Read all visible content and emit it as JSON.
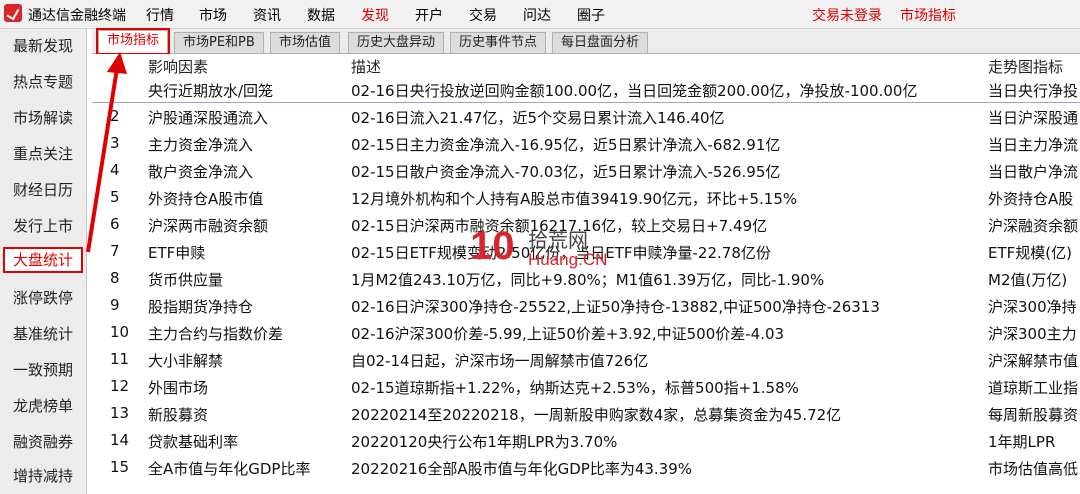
{
  "menubar": {
    "app_title": "通达信金融终端",
    "items": [
      "行情",
      "市场",
      "资讯",
      "数据",
      "发现",
      "开户",
      "交易",
      "问达",
      "圈子"
    ],
    "active_item": "发现",
    "status": "交易未登录",
    "right_link": "市场指标",
    "accent_color": "#e00000"
  },
  "sidebar": {
    "items": [
      "最新发现",
      "热点专题",
      "市场解读",
      "重点关注",
      "财经日历",
      "发行上市",
      "大盘统计",
      "涨停跌停",
      "基准统计",
      "一致预期",
      "龙虎榜单",
      "融资融券",
      "增持减持"
    ],
    "active_item": "大盘统计"
  },
  "tabs": {
    "items": [
      "市场指标",
      "市场PE和PB",
      "市场估值",
      "历史大盘异动",
      "历史事件节点",
      "每日盘面分析"
    ],
    "active_item": "市场指标"
  },
  "table": {
    "headers": {
      "factor": "影响因素",
      "desc": "描述",
      "chart": "走势图指标"
    },
    "rows": [
      {
        "num": "",
        "factor": "央行近期放水/回笼",
        "desc": "02-16日央行投放逆回购金额100.00亿，当日回笼金额200.00亿，净投放-100.00亿",
        "chart": "当日央行净投"
      },
      {
        "num": "2",
        "factor": "沪股通深股通流入",
        "desc": "02-16日流入21.47亿，近5个交易日累计流入146.40亿",
        "chart": "当日沪深股通"
      },
      {
        "num": "3",
        "factor": "主力资金净流入",
        "desc": "02-15日主力资金净流入-16.95亿，近5日累计净流入-682.91亿",
        "chart": "当日主力净流"
      },
      {
        "num": "4",
        "factor": "散户资金净流入",
        "desc": "02-15日散户资金净流入-70.03亿，近5日累计净流入-526.95亿",
        "chart": "当日散户净流"
      },
      {
        "num": "5",
        "factor": "外资持仓A股市值",
        "desc": "12月境外机构和个人持有A股总市值39419.90亿元，环比+5.15%",
        "chart": "外资持仓A股"
      },
      {
        "num": "6",
        "factor": "沪深两市融资余额",
        "desc": "02-15日沪深两市融资余额16217.16亿，较上交易日+7.49亿",
        "chart": "沪深融资余额"
      },
      {
        "num": "7",
        "factor": "ETF申赎",
        "desc": "02-15日ETF规模变动2.50亿份，当日ETF申赎净量-22.78亿份",
        "chart": "ETF规模(亿)"
      },
      {
        "num": "8",
        "factor": "货币供应量",
        "desc": "1月M2值243.10万亿，同比+9.80%；M1值61.39万亿，同比-1.90%",
        "chart": "M2值(万亿)"
      },
      {
        "num": "9",
        "factor": "股指期货净持仓",
        "desc": "02-16日沪深300净持仓-25522,上证50净持仓-13882,中证500净持仓-26313",
        "chart": "沪深300净持"
      },
      {
        "num": "10",
        "factor": "主力合约与指数价差",
        "desc": "02-16沪深300价差-5.99,上证50价差+3.92,中证500价差-4.03",
        "chart": "沪深300主力"
      },
      {
        "num": "11",
        "factor": "大小非解禁",
        "desc": "自02-14日起，沪深市场一周解禁市值726亿",
        "chart": "沪深解禁市值"
      },
      {
        "num": "12",
        "factor": "外围市场",
        "desc": "02-15道琼斯指+1.22%，纳斯达克+2.53%，标普500指+1.58%",
        "chart": "道琼斯工业指"
      },
      {
        "num": "13",
        "factor": "新股募资",
        "desc": "20220214至20220218，一周新股申购家数4家，总募集资金为45.72亿",
        "chart": "每周新股募资"
      },
      {
        "num": "14",
        "factor": "贷款基础利率",
        "desc": "20220120央行公布1年期LPR为3.70%",
        "chart": "1年期LPR"
      },
      {
        "num": "15",
        "factor": "全A市值与年化GDP比率",
        "desc": "20220216全部A股市值与年化GDP比率为43.39%",
        "chart": "市场估值高低"
      }
    ]
  },
  "watermark": {
    "mark": "10",
    "cn": "拾荒网",
    "url": "Huang.CN"
  }
}
